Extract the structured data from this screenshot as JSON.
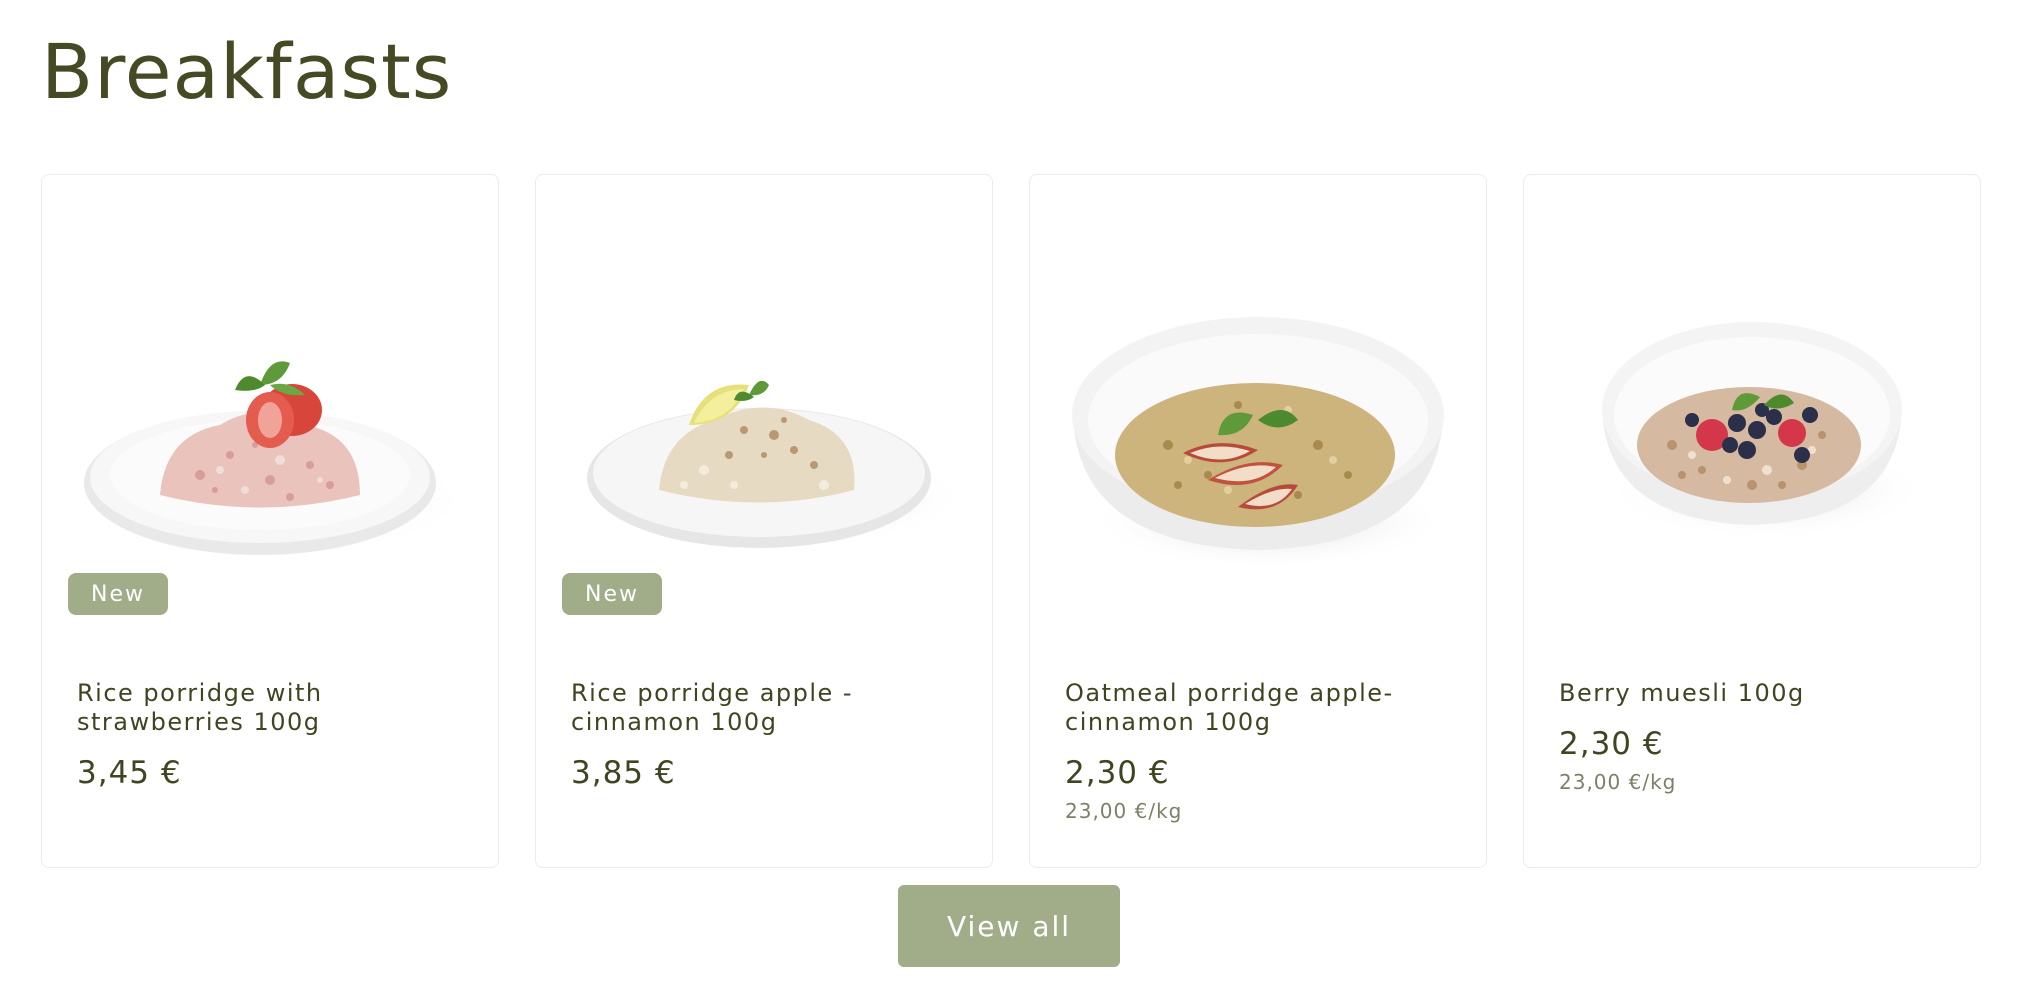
{
  "section": {
    "title": "Breakfasts"
  },
  "products": [
    {
      "name": "Rice porridge with strawberries 100g",
      "price": "3,45 €",
      "unit_price": "",
      "badge": "New",
      "image_icon": "rice-porridge-strawberries-image"
    },
    {
      "name": "Rice porridge apple - cinnamon 100g",
      "price": "3,85 €",
      "unit_price": "",
      "badge": "New",
      "image_icon": "rice-porridge-apple-cinnamon-image"
    },
    {
      "name": "Oatmeal porridge apple-cinnamon 100g",
      "price": "2,30 €",
      "unit_price": "23,00 €/kg",
      "badge": "",
      "image_icon": "oatmeal-porridge-image"
    },
    {
      "name": "Berry muesli 100g",
      "price": "2,30 €",
      "unit_price": "23,00 €/kg",
      "badge": "",
      "image_icon": "berry-muesli-image"
    }
  ],
  "view_all": {
    "label": "View all"
  },
  "colors": {
    "accent": "#a1ac89",
    "text": "#3f4521",
    "muted": "#7d8068",
    "border": "#ececec"
  }
}
